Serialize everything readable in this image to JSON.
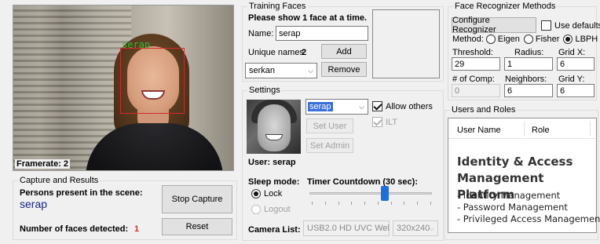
{
  "camera": {
    "face_label": "serap",
    "framerate_label": "Framerate: 2"
  },
  "capture": {
    "title": "Capture and Results",
    "persons_label": "Persons present in the scene:",
    "persons_value": "serap",
    "faces_label": "Number of faces detected:",
    "faces_value": "1",
    "stop_button": "Stop Capture",
    "reset_button": "Reset"
  },
  "training": {
    "title": "Training Faces",
    "instruction": "Please show 1 face at a time.",
    "name_label": "Name:",
    "name_value": "serap",
    "unique_label": "Unique names:",
    "unique_value": "2",
    "add_button": "Add",
    "remove_button": "Remove",
    "names_combo_value": "serkan"
  },
  "settings": {
    "title": "Settings",
    "user_combo_value": "serap",
    "allow_others_label": "Allow others",
    "allow_others_checked": true,
    "ilt_label": "ILT",
    "ilt_checked": true,
    "set_user_button": "Set User",
    "set_admin_button": "Set Admin",
    "user_label": "User: serap",
    "sleep_mode_label": "Sleep mode:",
    "lock_label": "Lock",
    "logout_label": "Logout",
    "sleep_mode_selected": "Lock",
    "timer_label": "Timer Countdown (30 sec):",
    "timer_value_seconds": 30,
    "camera_list_label": "Camera List:",
    "camera_value": "USB2.0 HD UVC Wel",
    "resolution_value": "320x240"
  },
  "recognizer": {
    "title": "Face Recognizer Methods",
    "configure_button": "Configure Recognizer",
    "use_defaults_label": "Use defaults",
    "use_defaults_checked": false,
    "method_label": "Method:",
    "methods": [
      "Eigen",
      "Fisher",
      "LBPH"
    ],
    "method_selected": "LBPH",
    "threshold_label": "Threshold:",
    "threshold_value": "29",
    "radius_label": "Radius:",
    "radius_value": "1",
    "gridx_label": "Grid X:",
    "gridx_value": "6",
    "comp_label": "# of Comp:",
    "comp_value": "0",
    "neighbors_label": "Neighbors:",
    "neighbors_value": "6",
    "gridy_label": "Grid Y:",
    "gridy_value": "6"
  },
  "users_roles": {
    "title": "Users and Roles",
    "columns": [
      "User Name",
      "Role"
    ],
    "overlay_title": "Identity & Access Management Platform",
    "overlay_items": [
      "- Identity Management",
      "- Password Management",
      "- Privileged Access Management"
    ]
  }
}
